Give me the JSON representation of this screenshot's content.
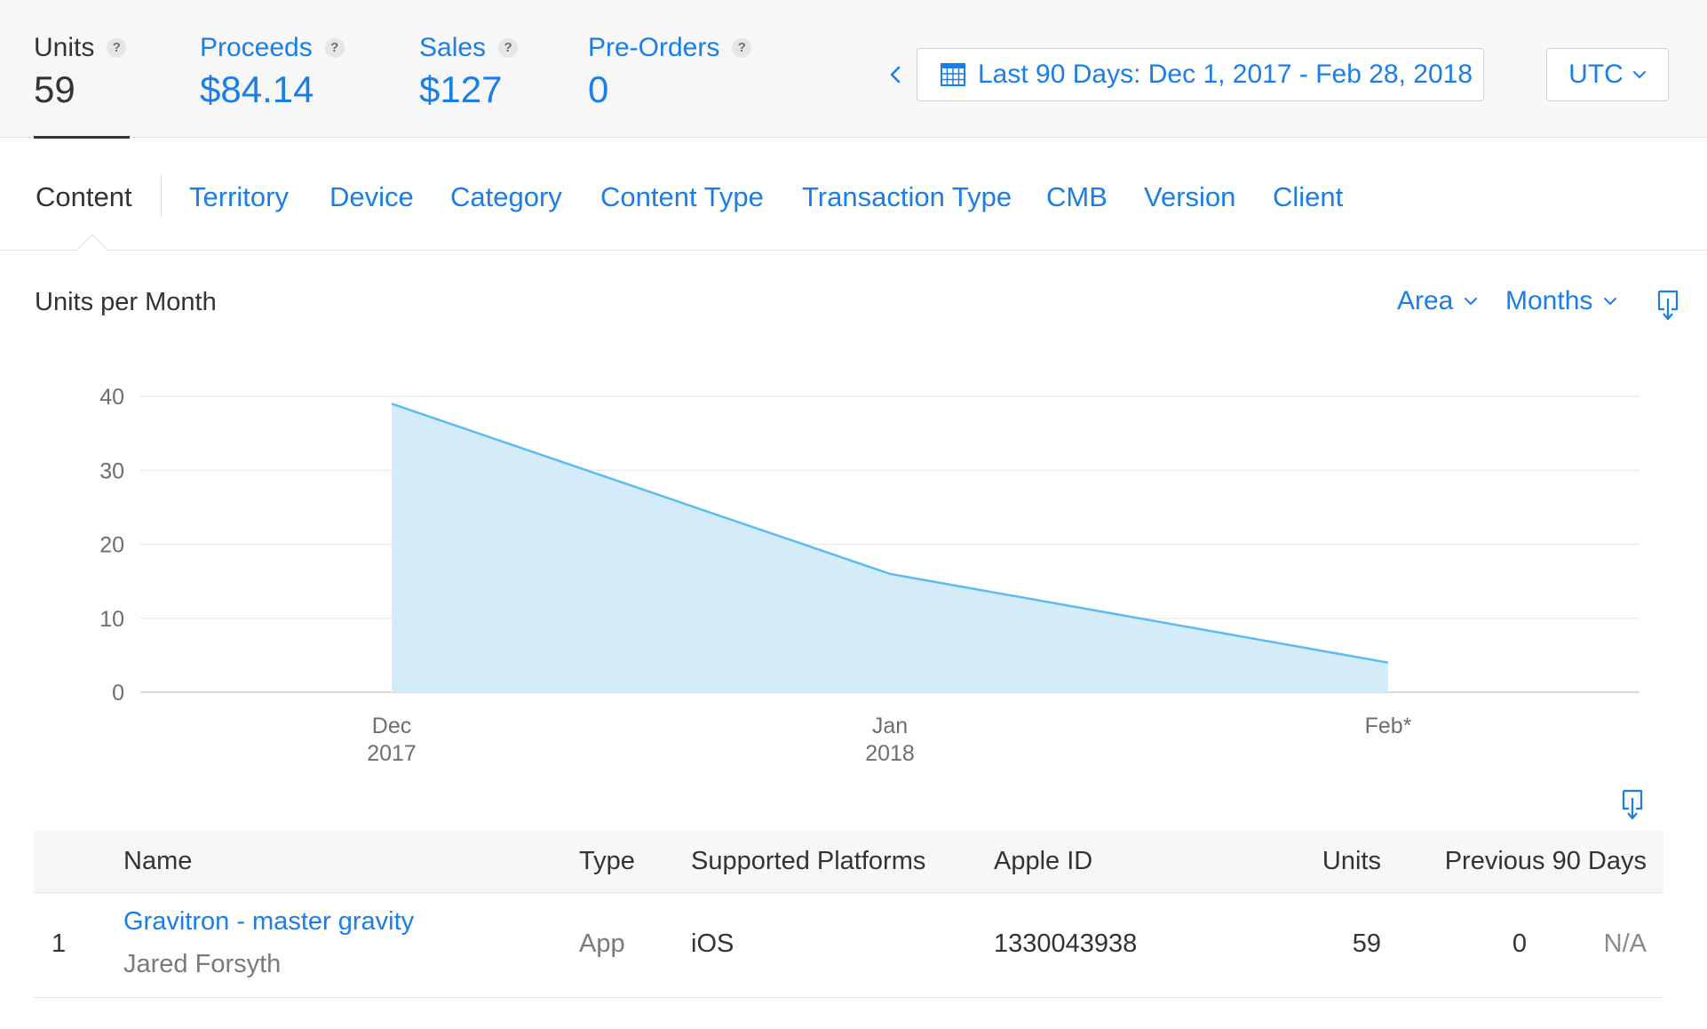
{
  "metrics": [
    {
      "label": "Units",
      "value": "59",
      "help": "?"
    },
    {
      "label": "Proceeds",
      "value": "$84.14",
      "help": "?"
    },
    {
      "label": "Sales",
      "value": "$127",
      "help": "?"
    },
    {
      "label": "Pre-Orders",
      "value": "0",
      "help": "?"
    }
  ],
  "date_range": {
    "label": "Last 90 Days: Dec 1, 2017 - Feb 28, 2018"
  },
  "timezone": {
    "label": "UTC"
  },
  "tabs": [
    {
      "label": "Content"
    },
    {
      "label": "Territory"
    },
    {
      "label": "Device"
    },
    {
      "label": "Category"
    },
    {
      "label": "Content Type"
    },
    {
      "label": "Transaction Type"
    },
    {
      "label": "CMB"
    },
    {
      "label": "Version"
    },
    {
      "label": "Client"
    }
  ],
  "chart_header": {
    "title": "Units per Month",
    "chart_type_label": "Area",
    "interval_label": "Months"
  },
  "colors": {
    "accent": "#1a7ee6",
    "area_fill": "#d4ecfa",
    "area_stroke": "#5bbcf0"
  },
  "icons": {
    "date_range": "calendar-icon",
    "previous": "chevron-left-icon",
    "dropdown": "chevron-down-icon",
    "export": "download-icon",
    "help": "help-icon"
  },
  "chart_data": {
    "type": "area",
    "title": "Units per Month",
    "categories": [
      {
        "label": "Dec",
        "sublabel": "2017"
      },
      {
        "label": "Jan",
        "sublabel": "2018"
      },
      {
        "label": "Feb*",
        "sublabel": ""
      }
    ],
    "values": [
      39,
      16,
      4
    ],
    "yticks": [
      0,
      10,
      20,
      30,
      40
    ],
    "ylim": [
      0,
      40
    ],
    "grid": true,
    "legend": "none"
  },
  "table": {
    "headers": {
      "name": "Name",
      "type": "Type",
      "platforms": "Supported Platforms",
      "apple_id": "Apple ID",
      "units": "Units",
      "previous": "Previous 90 Days"
    },
    "rows": [
      {
        "rank": "1",
        "name": "Gravitron - master gravity",
        "developer": "Jared Forsyth",
        "type": "App",
        "platforms": "iOS",
        "apple_id": "1330043938",
        "units": "59",
        "previous": "0",
        "change": "N/A"
      }
    ]
  }
}
